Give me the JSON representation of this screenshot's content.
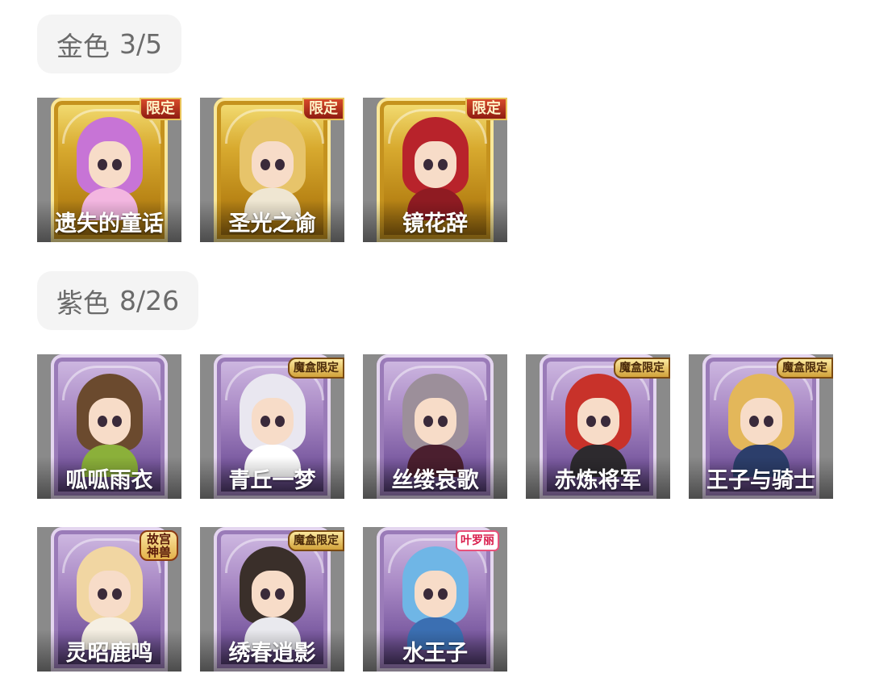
{
  "gold": {
    "label": "金色",
    "count": "3/5",
    "skins": [
      {
        "name": "遗失的童话",
        "tag": "限定",
        "hair": "#c774d6",
        "outfit": "#f3b6e0"
      },
      {
        "name": "圣光之谕",
        "tag": "限定",
        "hair": "#e7c46a",
        "outfit": "#efe6d2"
      },
      {
        "name": "镜花辞",
        "tag": "限定",
        "hair": "#b8232b",
        "outfit": "#8f1b22"
      }
    ]
  },
  "purple": {
    "label": "紫色",
    "count": "8/26",
    "skins": [
      {
        "name": "呱呱雨衣",
        "tag": "",
        "hair": "#6b4a2e",
        "outfit": "#8bb03a"
      },
      {
        "name": "青丘一梦",
        "tag": "魔盒限定",
        "hair": "#e9e7f0",
        "outfit": "#ffffff"
      },
      {
        "name": "丝缕哀歌",
        "tag": "",
        "hair": "#9c8f9a",
        "outfit": "#4b1f2f"
      },
      {
        "name": "赤炼将军",
        "tag": "魔盒限定",
        "hair": "#c8322a",
        "outfit": "#2d2a2e"
      },
      {
        "name": "王子与骑士",
        "tag": "魔盒限定",
        "hair": "#e3b75a",
        "outfit": "#2c3e6b"
      },
      {
        "name": "灵昭鹿鸣",
        "tag": "故宫神兽",
        "hair": "#f1d6a2",
        "outfit": "#f5efe3"
      },
      {
        "name": "绣春逍影",
        "tag": "魔盒限定",
        "hair": "#3a2f2a",
        "outfit": "#e9e9ee"
      },
      {
        "name": "水王子",
        "tag": "叶罗丽",
        "hair": "#6fb6e6",
        "outfit": "#3b6fb2"
      }
    ]
  }
}
